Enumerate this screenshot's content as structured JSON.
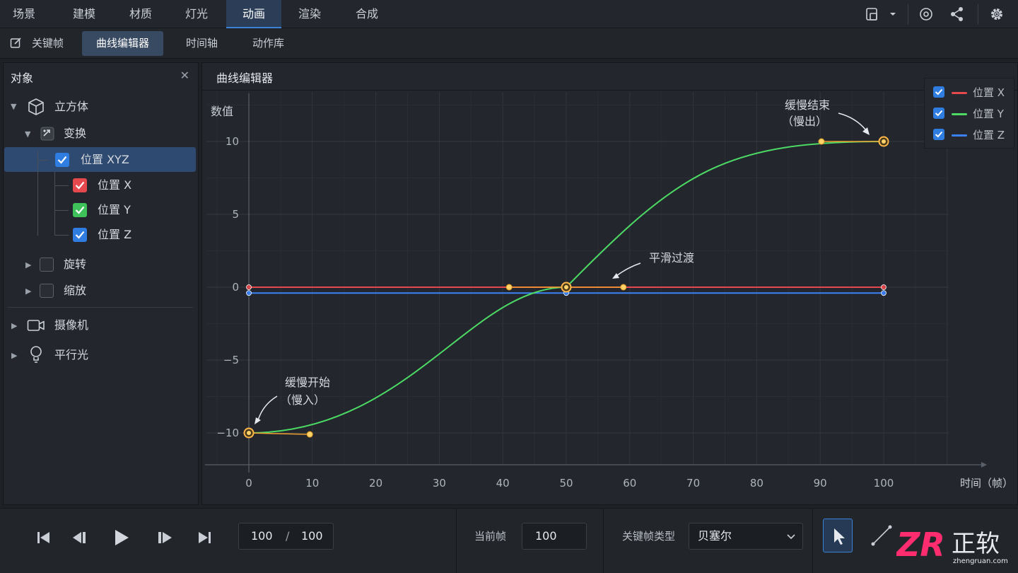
{
  "menu": {
    "items": [
      "场景",
      "建模",
      "材质",
      "灯光",
      "动画",
      "渲染",
      "合成"
    ],
    "active_index": 4
  },
  "subtabs": {
    "items": [
      "关键帧",
      "曲线编辑器",
      "时间轴",
      "动作库"
    ],
    "active_index": 1
  },
  "objects_panel": {
    "title": "对象",
    "cube": "立方体",
    "transform": "变换",
    "position_xyz": "位置 XYZ",
    "pos_x": "位置 X",
    "pos_y": "位置 Y",
    "pos_z": "位置 Z",
    "rotation": "旋转",
    "scale": "缩放",
    "camera": "摄像机",
    "directional_light": "平行光"
  },
  "curve_editor": {
    "title": "曲线编辑器"
  },
  "legend": [
    {
      "label": "位置 X",
      "color": "#e5484d"
    },
    {
      "label": "位置 Y",
      "color": "#4cd964"
    },
    {
      "label": "位置 Z",
      "color": "#3b82f6"
    }
  ],
  "chart_data": {
    "type": "line",
    "xlabel": "时间（帧）",
    "ylabel": "数值",
    "xlim": [
      0,
      100
    ],
    "ylim": [
      -10,
      10
    ],
    "xticks": [
      0,
      10,
      20,
      30,
      40,
      50,
      60,
      70,
      80,
      90,
      100
    ],
    "yticks": [
      10,
      5,
      0,
      -5,
      -10
    ],
    "grid": true,
    "legend_position": "top-right",
    "series": [
      {
        "name": "位置 X",
        "color": "#e5484d",
        "keyframes": [
          [
            0,
            0
          ],
          [
            50,
            0
          ],
          [
            100,
            0
          ]
        ]
      },
      {
        "name": "位置 Y",
        "color": "#4cd964",
        "keyframes": [
          [
            0,
            -10
          ],
          [
            50,
            0
          ],
          [
            100,
            10
          ]
        ],
        "handles": [
          [
            [
              9.6,
              -10.1
            ]
          ],
          [
            [
              41,
              0
            ],
            [
              59,
              0
            ]
          ],
          [
            [
              90.2,
              10
            ]
          ]
        ]
      },
      {
        "name": "位置 Z",
        "color": "#3b82f6",
        "keyframes": [
          [
            0,
            -0.4
          ],
          [
            50,
            -0.4
          ],
          [
            100,
            -0.4
          ]
        ]
      }
    ],
    "annotations": [
      {
        "text": "缓慢开始",
        "text2": "（慢入）",
        "x": 0,
        "y": -10
      },
      {
        "text": "平滑过渡",
        "x": 50,
        "y": 0
      },
      {
        "text": "缓慢结束",
        "text2": "（慢出）",
        "x": 100,
        "y": 10
      }
    ]
  },
  "playback": {
    "current": "100",
    "separator": "/",
    "total": "100",
    "current_frame_label": "当前帧",
    "current_frame_value": "100",
    "keyframe_type_label": "关键帧类型",
    "keyframe_type_value": "贝塞尔"
  },
  "watermark": {
    "logo": "ZR",
    "brand": "正软",
    "site": "zhengruan.com"
  }
}
